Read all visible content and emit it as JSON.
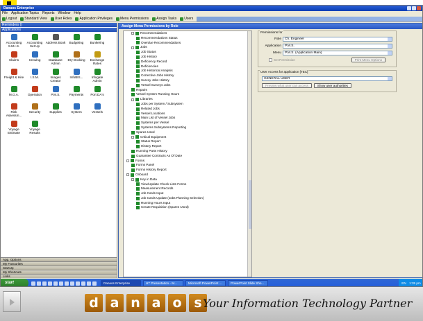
{
  "window": {
    "title": "Danaos Enterprise",
    "menu": [
      "File",
      "Application Topics",
      "Reports",
      "Window",
      "Help"
    ],
    "toolbar": [
      "Logout",
      "Standard View",
      "User Roles",
      "Application Privileges",
      "Menu Permissions",
      "Assign Tasks",
      "Users"
    ]
  },
  "left_panel": {
    "header_top": "Reminders ()",
    "header_apps": "Applications",
    "icons": [
      {
        "label": "Accounting S.M.I.S.",
        "color": "#2f6fbf"
      },
      {
        "label": "Accounting Set Up",
        "color": "#1f8a2a"
      },
      {
        "label": "Address Book",
        "color": "#555555"
      },
      {
        "label": "Budgeting",
        "color": "#1f8a2a"
      },
      {
        "label": "Bunkering",
        "color": "#1f8a2a"
      },
      {
        "label": "Claims",
        "color": "#c23b1b"
      },
      {
        "label": "Crewing",
        "color": "#2f6fbf"
      },
      {
        "label": "Database Admin",
        "color": "#1f8a2a"
      },
      {
        "label": "Dry Docking",
        "color": "#b0701a"
      },
      {
        "label": "Exchange Rates",
        "color": "#c29b12"
      },
      {
        "label": "Freight & Hire",
        "color": "#c23b1b"
      },
      {
        "label": "I.S.M.",
        "color": "#2f6fbf"
      },
      {
        "label": "Images Creator",
        "color": "#1f8a2a"
      },
      {
        "label": "InfoBIS...",
        "color": "#2f6fbf"
      },
      {
        "label": "Infogate Admin",
        "color": "#1f8a2a"
      },
      {
        "label": "M.G.A.",
        "color": "#1f8a2a"
      },
      {
        "label": "Operation",
        "color": "#c23b1b"
      },
      {
        "label": "P.M.S.",
        "color": "#2f6fbf"
      },
      {
        "label": "Payments",
        "color": "#1f8a2a"
      },
      {
        "label": "Port DA's",
        "color": "#1f8a2a"
      },
      {
        "label": "Risk Assessm...",
        "color": "#c23b1b"
      },
      {
        "label": "Security",
        "color": "#b0701a"
      },
      {
        "label": "Supplies",
        "color": "#1f8a2a"
      },
      {
        "label": "System",
        "color": "#2f6fbf"
      },
      {
        "label": "Vessels",
        "color": "#2f6fbf"
      },
      {
        "label": "Voyage Estimate",
        "color": "#c23b1b"
      },
      {
        "label": "Voyage Results",
        "color": "#1f8a2a"
      }
    ],
    "bottom_bars": [
      "App. Options",
      "My Favourites",
      "StartUp",
      "My Shortcuts",
      "Links"
    ]
  },
  "dialog": {
    "title": "Assign Menu Permissions by Role",
    "tree": [
      {
        "label": "Recommendations",
        "level": 2,
        "exp": true
      },
      {
        "label": "Recommendations Status",
        "level": 3
      },
      {
        "label": "Overdue Recommendations",
        "level": 3
      },
      {
        "label": "Jobs",
        "level": 2,
        "exp": true
      },
      {
        "label": "Job Status",
        "level": 3
      },
      {
        "label": "Job History",
        "level": 3
      },
      {
        "label": "Deficiency Record",
        "level": 3
      },
      {
        "label": "Deficiencies",
        "level": 3
      },
      {
        "label": "Job Historical Analysis",
        "level": 3
      },
      {
        "label": "Corrective Jobs History",
        "level": 3
      },
      {
        "label": "Survey Jobs History",
        "level": 3
      },
      {
        "label": "Vessel Surveys Jobs",
        "level": 3
      },
      {
        "label": "Repairs",
        "level": 2
      },
      {
        "label": "Vessel System Running Hours",
        "level": 2
      },
      {
        "label": "Libraries",
        "level": 2,
        "exp": true
      },
      {
        "label": "Jobs per System / Subsystem",
        "level": 3
      },
      {
        "label": "Related Jobs",
        "level": 3
      },
      {
        "label": "Vessel Locations",
        "level": 3
      },
      {
        "label": "Main List of Vessel Jobs",
        "level": 3
      },
      {
        "label": "Systems per Vessel",
        "level": 3
      },
      {
        "label": "Systems Subsystems Reporting",
        "level": 3
      },
      {
        "label": "Spares Used",
        "level": 2
      },
      {
        "label": "Critical Equipment",
        "level": 2,
        "exp": true
      },
      {
        "label": "Status Report",
        "level": 3
      },
      {
        "label": "History Report",
        "level": 3
      },
      {
        "label": "Running Parts History",
        "level": 2
      },
      {
        "label": "Guarantee Contracts As Of Date",
        "level": 2
      },
      {
        "label": "Forms",
        "level": 1,
        "exp": true
      },
      {
        "label": "Forms Panel",
        "level": 2
      },
      {
        "label": "Forms History Report",
        "level": 2
      },
      {
        "label": "Onboard",
        "level": 1,
        "exp": true
      },
      {
        "label": "Key in Data",
        "level": 2,
        "exp": true
      },
      {
        "label": "View/Update Check Lists Forms",
        "level": 3
      },
      {
        "label": "Measurement Records",
        "level": 3
      },
      {
        "label": "Job Cards Input",
        "level": 3
      },
      {
        "label": "Job Cards Update (Jobs Planning Selection)",
        "level": 3
      },
      {
        "label": "Running Hours Input",
        "level": 3
      },
      {
        "label": "Create Requisition (Spares Used)",
        "level": 3
      }
    ],
    "permissions_for": {
      "title": "Permissions for",
      "role_label": "Role",
      "role_value": "Ch. Engineer",
      "application_label": "Application",
      "application_value": "P.M.S.",
      "menu_label": "Menu",
      "menu_value": "P.M.S. (Application Main)",
      "checkbox_label": "Set Permission",
      "print_button": "Print Menu Options"
    },
    "user_access": {
      "title": "User Access for application [TEC]",
      "user_value": "GENERAL USER",
      "preview_button": "Preview what user can access",
      "show_button": "Show user authorities"
    }
  },
  "taskbar": {
    "start": "start",
    "tasks": [
      "Danaos Enterprise",
      "HT Presentation - M...",
      "Microsoft PowerPoint ...",
      "PowerPoint Slide Sho..."
    ],
    "tray": [
      "EN",
      "1:35 pm"
    ]
  },
  "footer": {
    "brand_letters": [
      "d",
      "a",
      "n",
      "a",
      "o",
      "s"
    ],
    "slogan": "Your Information Technology Partner"
  }
}
